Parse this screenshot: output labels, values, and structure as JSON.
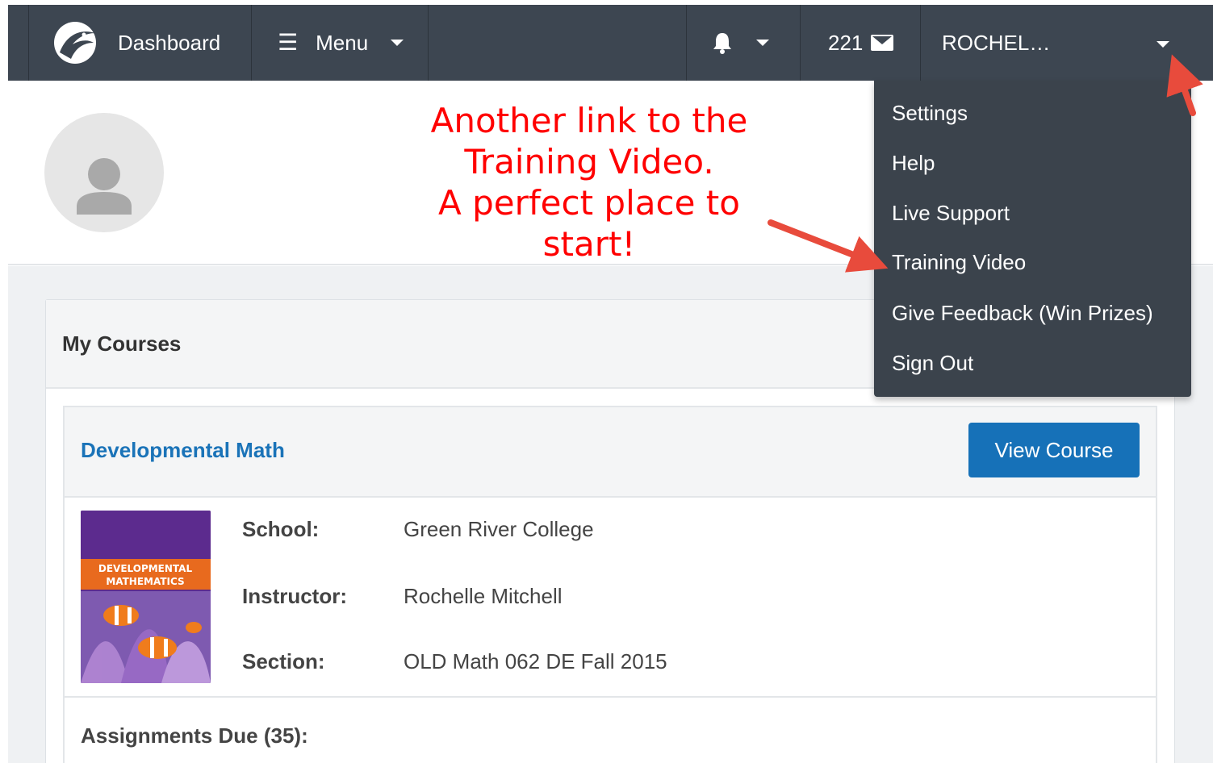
{
  "nav": {
    "dashboard_label": "Dashboard",
    "menu_label": "Menu",
    "mail_count": "221",
    "user_name": "ROCHEL…"
  },
  "annotation": {
    "lines": [
      "Another link to the",
      "Training Video.",
      "A perfect place to",
      "start!"
    ]
  },
  "dropdown": {
    "items": [
      "Settings",
      "Help",
      "Live Support",
      "Training Video",
      "Give Feedback (Win Prizes)",
      "Sign Out"
    ]
  },
  "courses": {
    "title": "My Courses",
    "course": {
      "name": "Developmental Math",
      "view_label": "View Course",
      "book_title_line1": "DEVELOPMENTAL",
      "book_title_line2": "MATHEMATICS",
      "fields": [
        {
          "label": "School:",
          "value": "Green River College"
        },
        {
          "label": "Instructor:",
          "value": "Rochelle Mitchell"
        },
        {
          "label": "Section:",
          "value": "OLD Math 062 DE Fall 2015"
        }
      ],
      "assignments_label": "Assignments Due (35):"
    }
  },
  "colors": {
    "nav_bg": "#3d4651",
    "annotation": "#ff0000",
    "link": "#1a73b8",
    "button": "#1671b8",
    "dropdown_bg": "#3b434c"
  }
}
